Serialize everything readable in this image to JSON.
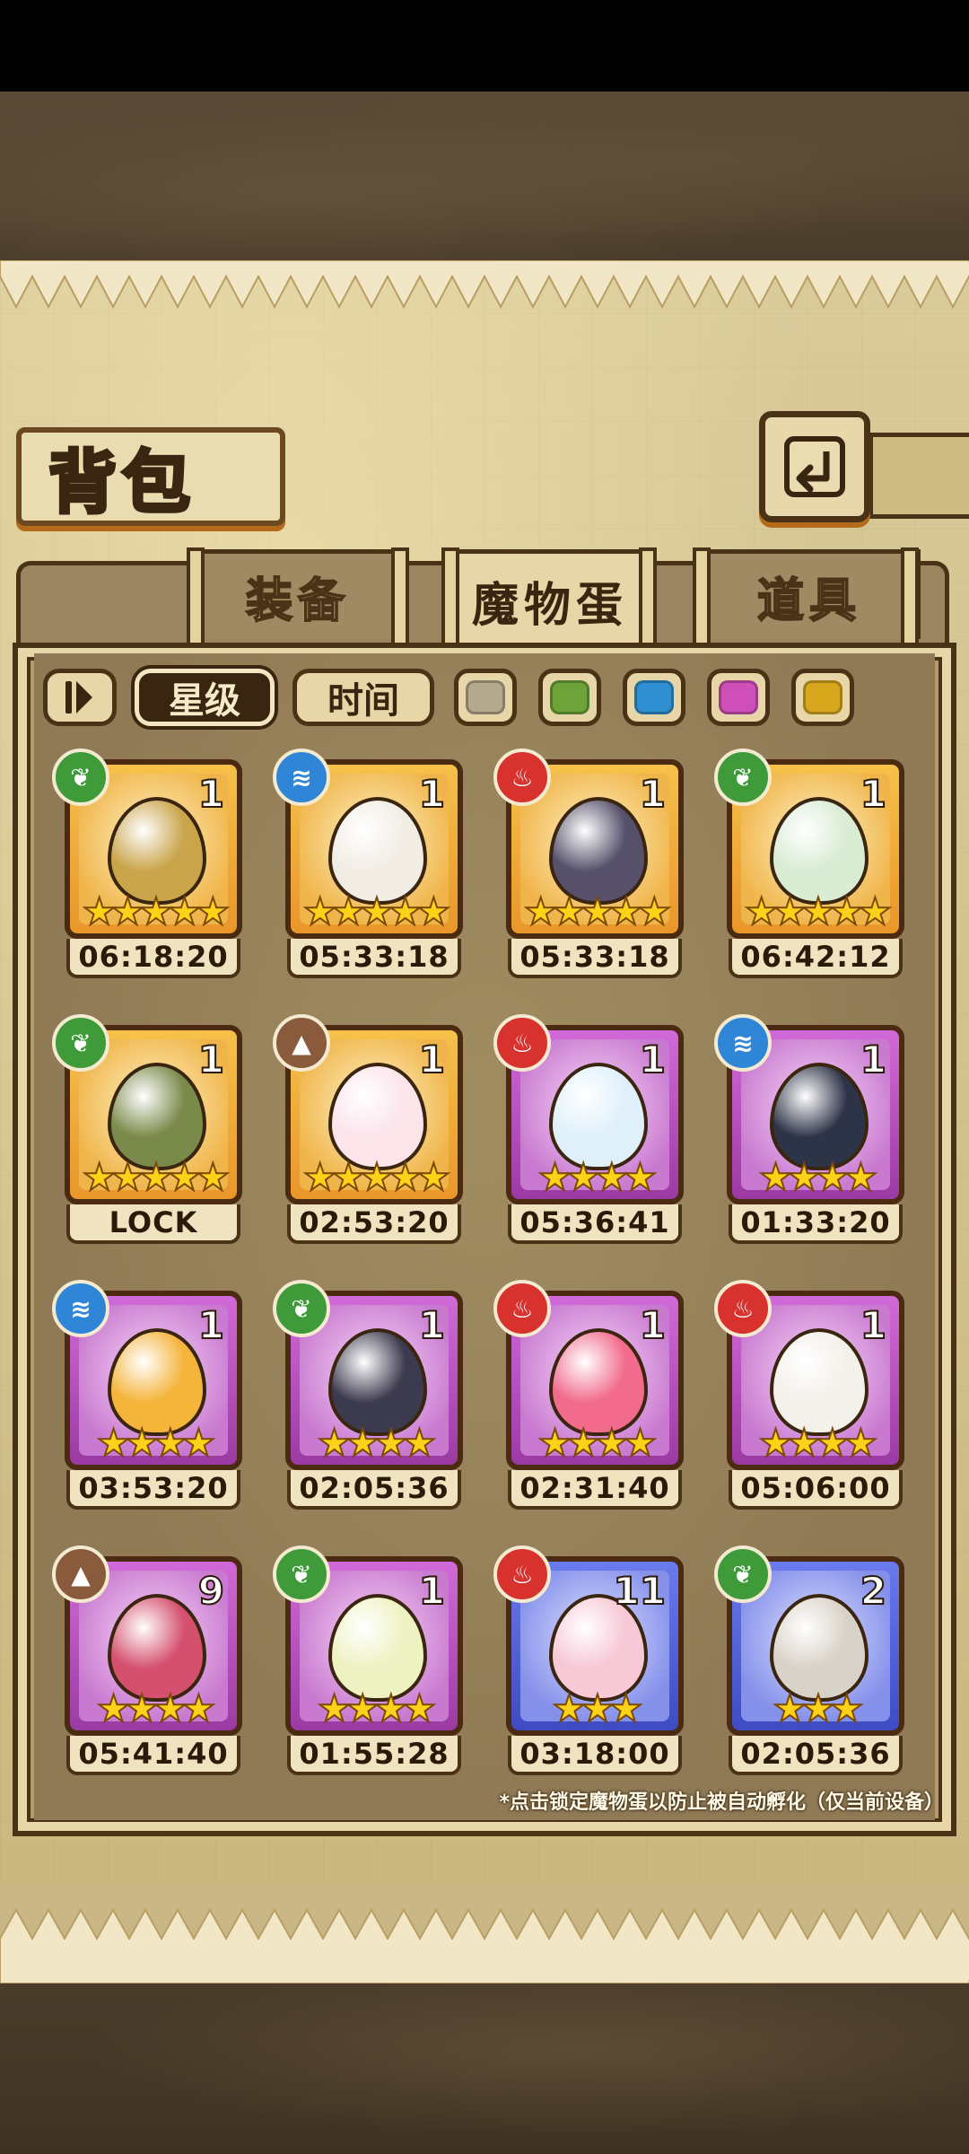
{
  "header": {
    "title": "背包"
  },
  "tabs": [
    {
      "label": "装备",
      "active": false
    },
    {
      "label": "魔物蛋",
      "active": true
    },
    {
      "label": "道具",
      "active": false
    }
  ],
  "filters": {
    "sort_star": "星级",
    "sort_time": "时间",
    "colors": [
      "#b4a98c",
      "#6ea33a",
      "#2f8fd0",
      "#cf4fb8",
      "#d8a71e"
    ]
  },
  "eggs": [
    {
      "element": "grass",
      "count": "1",
      "stars": "★★★★★",
      "rarity": "orange",
      "time": "06:18:20",
      "egg_color": "#c9a44a"
    },
    {
      "element": "water",
      "count": "1",
      "stars": "★★★★★",
      "rarity": "orange",
      "time": "05:33:18",
      "egg_color": "#f2ede4"
    },
    {
      "element": "fire",
      "count": "1",
      "stars": "★★★★★",
      "rarity": "orange",
      "time": "05:33:18",
      "egg_color": "#56506a"
    },
    {
      "element": "grass",
      "count": "1",
      "stars": "★★★★★",
      "rarity": "orange",
      "time": "06:42:12",
      "egg_color": "#d9ecd4"
    },
    {
      "element": "grass",
      "count": "1",
      "stars": "★★★★★",
      "rarity": "orange",
      "time": "LOCK",
      "egg_color": "#7a8a4a"
    },
    {
      "element": "earth",
      "count": "1",
      "stars": "★★★★★",
      "rarity": "orange",
      "time": "02:53:20",
      "egg_color": "#fbe4ea"
    },
    {
      "element": "fire",
      "count": "1",
      "stars": "★★★★",
      "rarity": "purple",
      "time": "05:36:41",
      "egg_color": "#dff0fb"
    },
    {
      "element": "water",
      "count": "1",
      "stars": "★★★★",
      "rarity": "purple",
      "time": "01:33:20",
      "egg_color": "#2e3448"
    },
    {
      "element": "water",
      "count": "1",
      "stars": "★★★★",
      "rarity": "purple",
      "time": "03:53:20",
      "egg_color": "#f5b43a"
    },
    {
      "element": "grass",
      "count": "1",
      "stars": "★★★★",
      "rarity": "purple",
      "time": "02:05:36",
      "egg_color": "#3c3a4e"
    },
    {
      "element": "fire",
      "count": "1",
      "stars": "★★★★",
      "rarity": "purple",
      "time": "02:31:40",
      "egg_color": "#f26a8c"
    },
    {
      "element": "fire",
      "count": "1",
      "stars": "★★★★",
      "rarity": "purple",
      "time": "05:06:00",
      "egg_color": "#f4f0ea"
    },
    {
      "element": "earth",
      "count": "9",
      "stars": "★★★★",
      "rarity": "purple",
      "time": "05:41:40",
      "egg_color": "#d4506e"
    },
    {
      "element": "grass",
      "count": "1",
      "stars": "★★★★",
      "rarity": "purple",
      "time": "01:55:28",
      "egg_color": "#eef2c2"
    },
    {
      "element": "fire",
      "count": "11",
      "stars": "★★★",
      "rarity": "blue",
      "time": "03:18:00",
      "egg_color": "#f7c8d6"
    },
    {
      "element": "grass",
      "count": "2",
      "stars": "★★★",
      "rarity": "blue",
      "time": "02:05:36",
      "egg_color": "#d9d2c8"
    }
  ],
  "footer_note": "*点击锁定魔物蛋以防止被自动孵化（仅当前设备）"
}
